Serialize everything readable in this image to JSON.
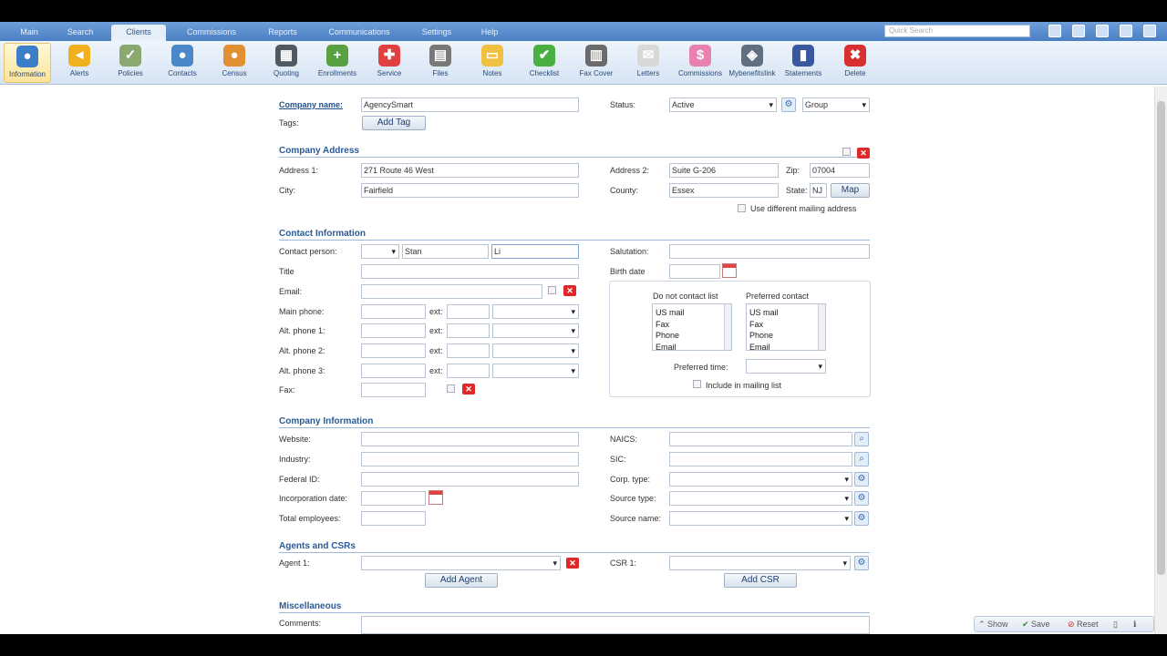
{
  "tabs": [
    "Main",
    "Search",
    "Clients",
    "Commissions",
    "Reports",
    "Communications",
    "Settings",
    "Help"
  ],
  "quick_search_placeholder": "Quick Search",
  "toolbar": [
    "Information",
    "Alerts",
    "Policies",
    "Contacts",
    "Census",
    "Quoting",
    "Enrollments",
    "Service",
    "Files",
    "Notes",
    "Checklist",
    "Fax Cover",
    "Letters",
    "Commissions",
    "MybenefitsIink",
    "Statements",
    "Delete"
  ],
  "colors": {
    "accent": "#4a7fc4",
    "section_title": "#2a5a98",
    "delete": "#e02828"
  },
  "header": {
    "company_name_label": "Company name:",
    "company_name_value": "AgencySmart",
    "tags_label": "Tags:",
    "add_tag": "Add Tag",
    "status_label": "Status:",
    "status_value": "Active",
    "group_value": "Group"
  },
  "address": {
    "title": "Company Address",
    "address1_label": "Address 1:",
    "address1_value": "271 Route 46 West",
    "address2_label": "Address 2:",
    "address2_value": "Suite G-206",
    "zip_label": "Zip:",
    "zip_value": "07004",
    "city_label": "City:",
    "city_value": "Fairfield",
    "county_label": "County:",
    "county_value": "Essex",
    "state_label": "State:",
    "state_value": "NJ",
    "map": "Map",
    "mailing": "Use different mailing address"
  },
  "contact": {
    "title": "Contact Information",
    "person_label": "Contact person:",
    "first_value": "Stan",
    "last_value": "Li",
    "salutation_label": "Salutation:",
    "title_label": "Title",
    "birth_label": "Birth date",
    "email_label": "Email:",
    "main_phone_label": "Main phone:",
    "alt1_label": "Alt. phone 1:",
    "alt2_label": "Alt. phone 2:",
    "alt3_label": "Alt. phone 3:",
    "fax_label": "Fax:",
    "ext_label": "ext:",
    "do_not_contact": "Do not contact list",
    "preferred_contact": "Preferred contact",
    "contact_options": [
      "US mail",
      "Fax",
      "Phone",
      "Email"
    ],
    "preferred_time": "Preferred time:",
    "include_mailing": "Include in mailing list"
  },
  "company": {
    "title": "Company Information",
    "website_label": "Website:",
    "industry_label": "Industry:",
    "federal_label": "Federal ID:",
    "inc_label": "Incorporation date:",
    "employees_label": "Total employees:",
    "naics_label": "NAICS:",
    "sic_label": "SIC:",
    "corp_label": "Corp. type:",
    "source_type_label": "Source type:",
    "source_name_label": "Source name:"
  },
  "agents": {
    "title": "Agents and CSRs",
    "agent_label": "Agent 1:",
    "csr_label": "CSR 1:",
    "add_agent": "Add Agent",
    "add_csr": "Add CSR"
  },
  "misc": {
    "title": "Miscellaneous",
    "comments_label": "Comments:"
  },
  "bottom": {
    "show": "Show",
    "save": "Save",
    "reset": "Reset"
  }
}
